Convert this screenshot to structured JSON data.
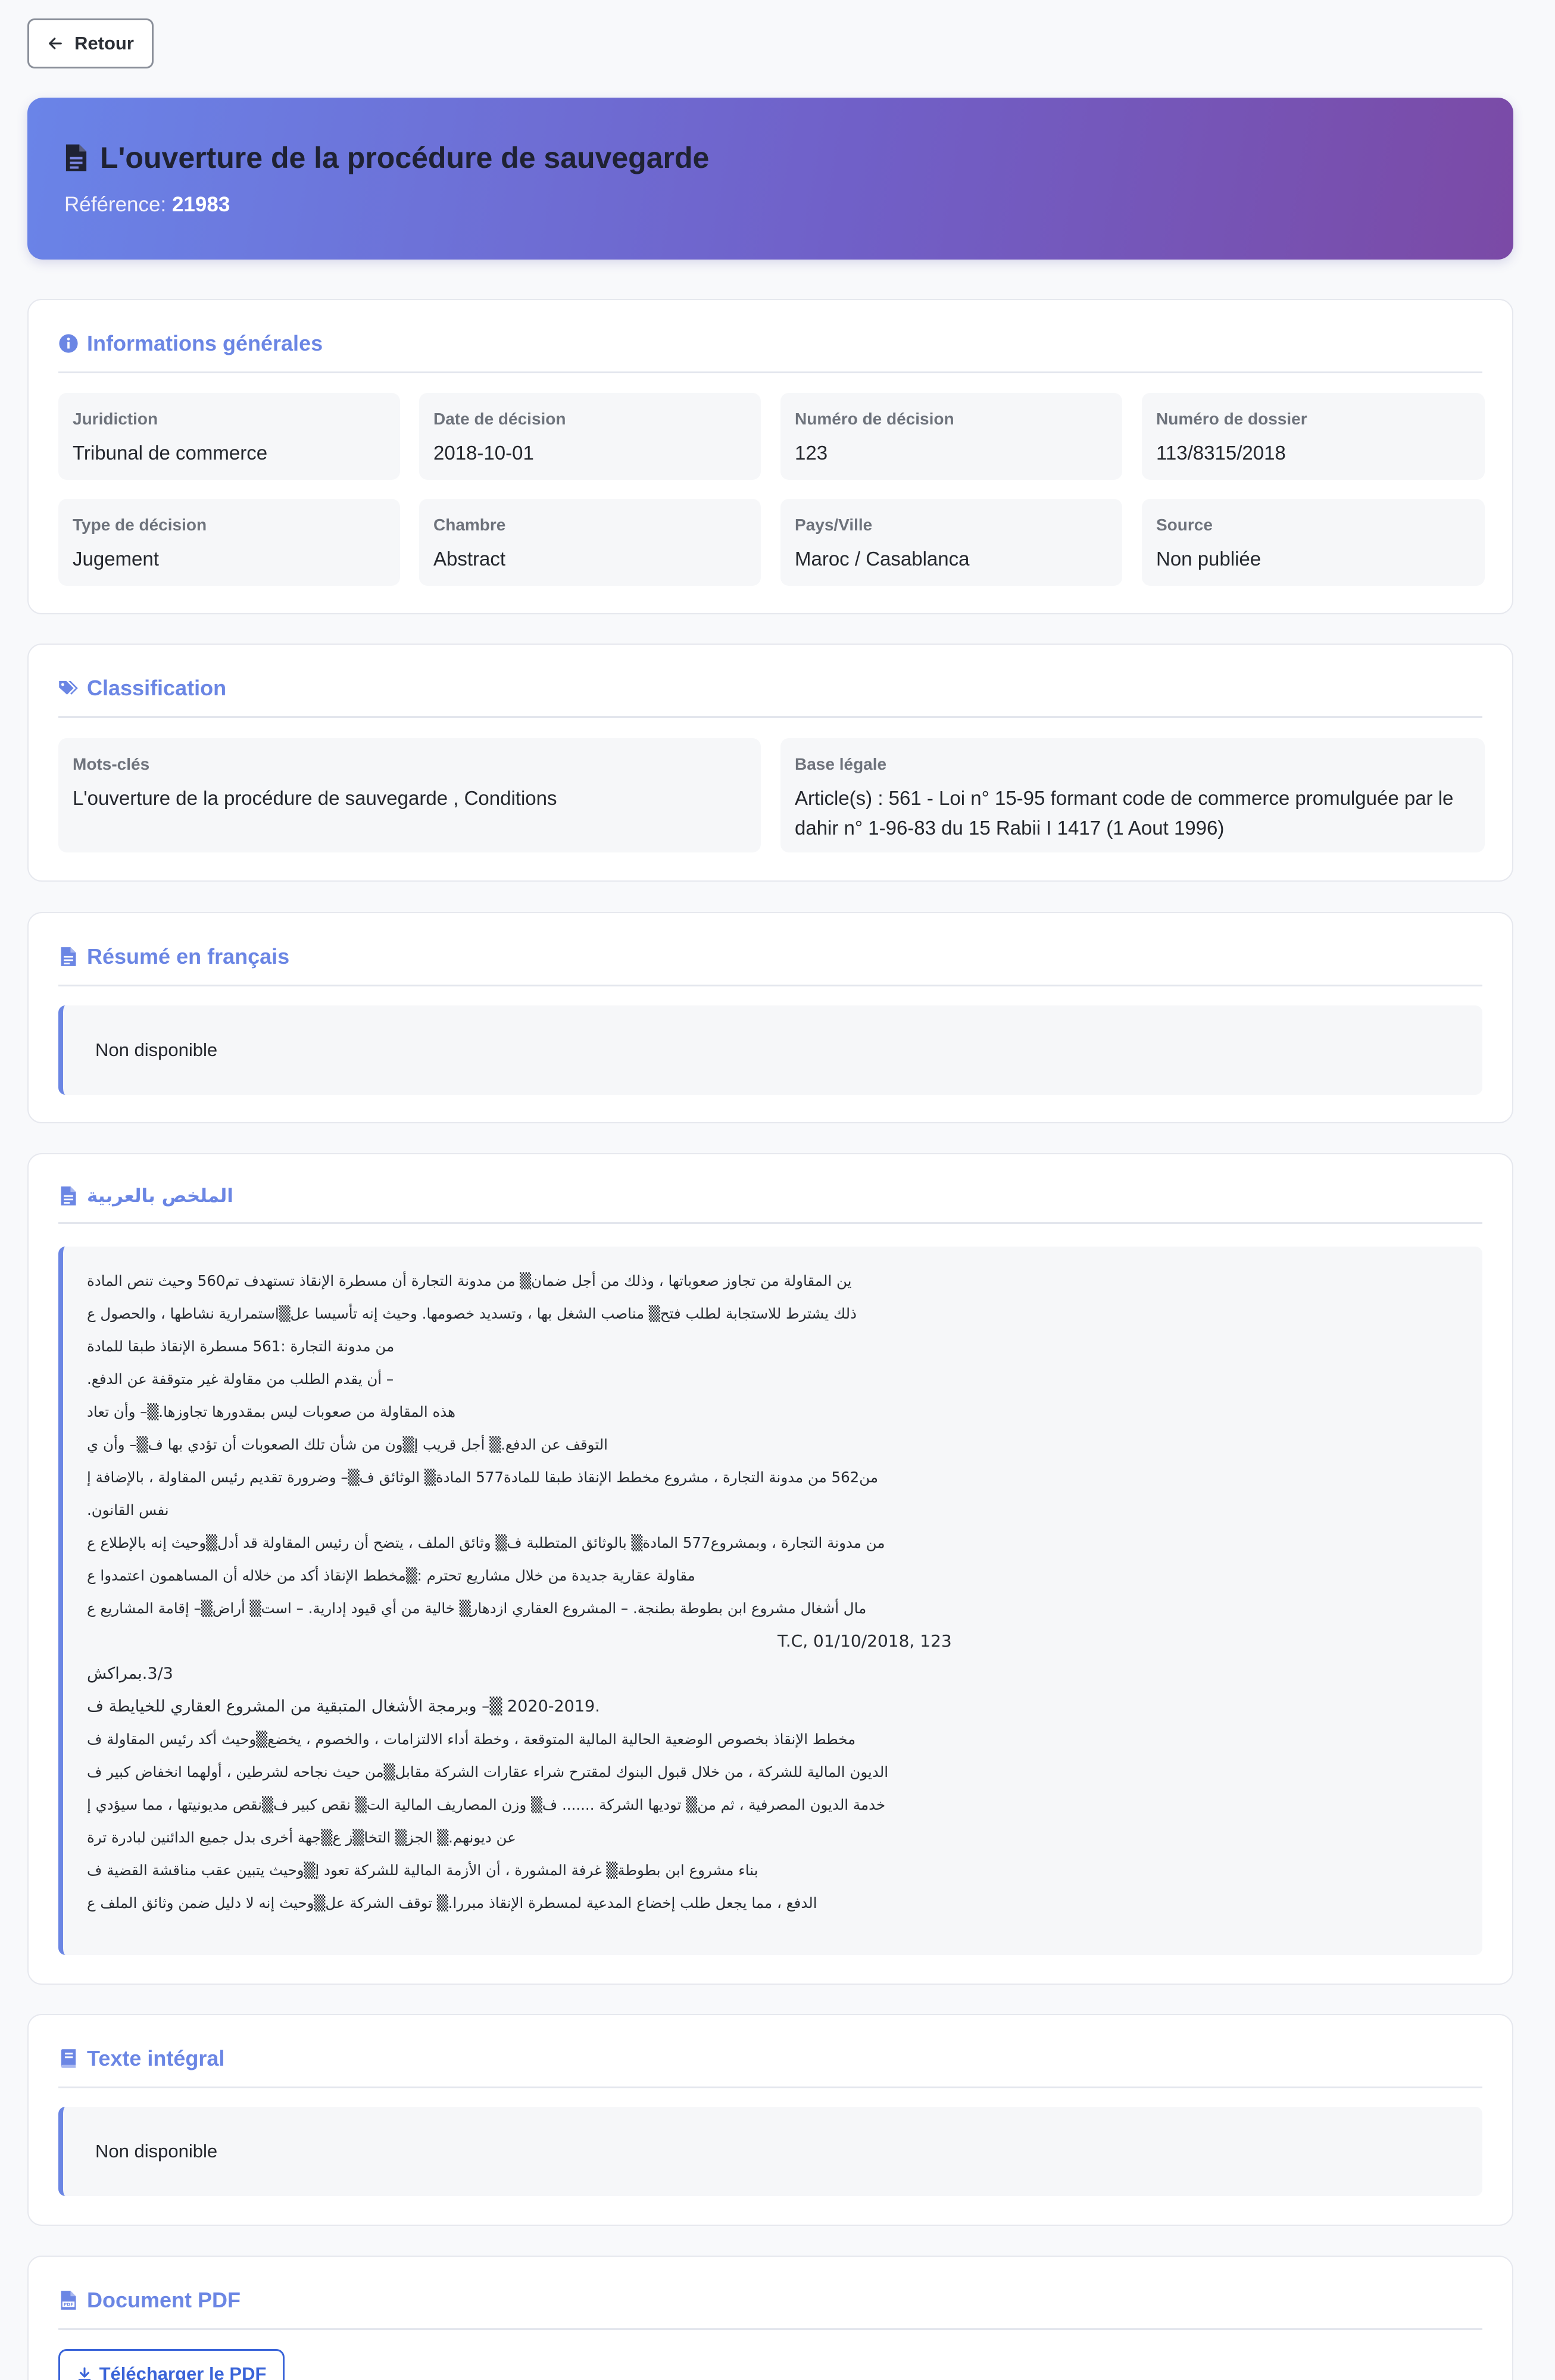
{
  "back_button": {
    "label": "Retour"
  },
  "header": {
    "title": "L'ouverture de la procédure de sauvegarde",
    "reference_label": "Référence:",
    "reference_value": "21983"
  },
  "general_info": {
    "heading": "Informations générales",
    "fields": [
      {
        "label": "Juridiction",
        "value": "Tribunal de commerce"
      },
      {
        "label": "Date de décision",
        "value": "2018-10-01"
      },
      {
        "label": "Numéro de décision",
        "value": "123"
      },
      {
        "label": "Numéro de dossier",
        "value": "113/8315/2018"
      },
      {
        "label": "Type de décision",
        "value": "Jugement"
      },
      {
        "label": "Chambre",
        "value": "Abstract"
      },
      {
        "label": "Pays/Ville",
        "value": "Maroc / Casablanca"
      },
      {
        "label": "Source",
        "value": "Non publiée"
      }
    ]
  },
  "classification": {
    "heading": "Classification",
    "keywords_label": "Mots-clés",
    "keywords_value": "L'ouverture de la procédure de sauvegarde , Conditions",
    "legal_label": "Base légale",
    "legal_value": "Article(s) : 561 - Loi n° 15-95 formant code de commerce promulguée par le dahir n° 1-96-83 du 15 Rabii I 1417 (1 Aout 1996)"
  },
  "summary_fr": {
    "heading": "Résumé en français",
    "text": "Non disponible"
  },
  "summary_ar": {
    "heading": "الملخص بالعربية",
    "lines": [
      "ين المقاولة من تجاوز صعوباتها ، وذلك من أجل ضمان▒ من مدونة التجارة أن مسطرة الإنقاذ تستهدف تم560 وحيث تنص المادة",
      "ذلك يشترط للاستجابة لطلب فتح▒ مناصب الشغل بها ، وتسديد خصومها. وحيث إنه تأسيسا عل▒استمرارية نشاطها ، والحصول ع",
      "من مدونة التجارة :561 مسطرة الإنقاذ طبقا للمادة",
      "– أن يقدم الطلب من مقاولة غير متوقفة عن الدفع.",
      "هذه المقاولة من صعوبات ليس بمقدورها تجاوزها.▒– وأن تعاد",
      "التوقف عن الدفع.▒ أجل قريب إ▒ون من شأن تلك الصعوبات أن تؤدي بها ف▒– وأن ي",
      "من562 من مدونة التجارة ، مشروع مخطط الإنقاذ طبقا للمادة577 المادة▒ الوثائق ف▒– وضرورة تقديم رئيس المقاولة ، بالإضافة إ",
      "نفس القانون.",
      "من مدونة التجارة ، وبمشروع577 المادة▒ بالوثائق المتطلبة ف▒ وثائق الملف ، يتضح أن رئيس المقاولة قد أدل▒وحيث إنه بالإطلاع ع",
      "مقاولة عقارية جديدة من خلال مشاريع تحترم :▒مخطط الإنقاذ أكد من خلاله أن المساهمون اعتمدوا ع",
      "مال أشغال مشروع ابن بطوطة بطنجة. – المشروع العقاري ازدهار▒ خالية من أي قيود إدارية. – است▒ أراض▒– إقامة المشاريع ع",
      "T.C, 01/10/2018, 123",
      "3/3.بمراكش",
      ".2020-2019 ▒– وبرمجة الأشغال المتبقية من المشروع العقاري للخيايطة ف",
      "مخطط الإنقاذ بخصوص الوضعية الحالية المالية المتوقعة ، وخطة أداء الالتزامات ، والخصوم ، يخضع▒وحيث أكد رئيس المقاولة ف",
      "الديون المالية للشركة ، من خلال قبول البنوك لمقترح شراء عقارات الشركة مقابل▒من حيث نجاحه لشرطين ، أولهما انخفاض كبير ف",
      "خدمة الديون المصرفية ، ثم من▒ توديها الشركة ....... ف▒ وزن المصاريف المالية الت▒ نقص كبير ف▒نقص مديونيتها ، مما سيؤدي إ",
      "عن ديونهم.▒ الجز▒ التخا▒ز ع▒جهة أخرى بدل جميع الدائنين لبادرة ترة",
      "بناء مشروع ابن بطوطة▒ غرفة المشورة ، أن الأزمة المالية للشركة تعود إ▒وحيث يتبين عقب مناقشة القضية ف",
      "الدفع ، مما يجعل طلب إخضاع المدعية لمسطرة الإنقاذ مبررا.▒ توقف الشركة عل▒وحيث إنه لا دليل ضمن وثائق الملف ع"
    ]
  },
  "full_text": {
    "heading": "Texte intégral",
    "text": "Non disponible"
  },
  "pdf": {
    "heading": "Document PDF",
    "button_label": "Télécharger le PDF"
  }
}
